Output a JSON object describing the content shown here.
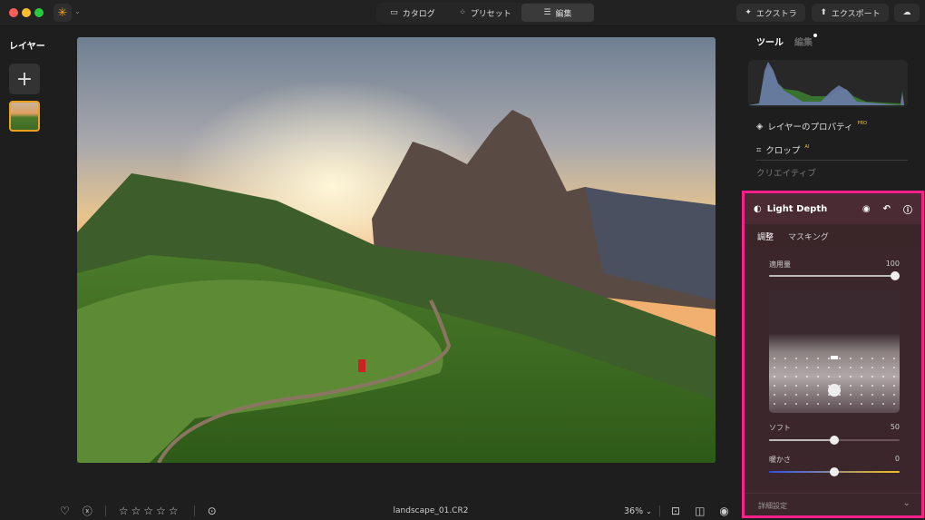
{
  "topbar": {
    "catalog": "カタログ",
    "presets": "プリセット",
    "edit": "編集",
    "extras": "エクストラ",
    "export": "エクスポート"
  },
  "left": {
    "title": "レイヤー"
  },
  "right": {
    "tab_tools": "ツール",
    "tab_edit": "編集",
    "layer_props": "レイヤーのプロパティ",
    "pro_badge": "PRO",
    "crop": "クロップ",
    "ai_badge": "AI",
    "creative": "クリエイティブ"
  },
  "light_depth": {
    "title": "Light Depth",
    "tab_adjust": "調整",
    "tab_masking": "マスキング",
    "amount_label": "適用量",
    "amount_value": "100",
    "soft_label": "ソフト",
    "soft_value": "50",
    "warmth_label": "暖かさ",
    "warmth_value": "0",
    "advanced": "詳細設定"
  },
  "bottom": {
    "filename": "landscape_01.CR2",
    "zoom": "36%",
    "rating": 0
  },
  "colors": {
    "accent": "#ff1f8a",
    "panel": "#3b262c",
    "thumb_border": "#f0a020"
  }
}
